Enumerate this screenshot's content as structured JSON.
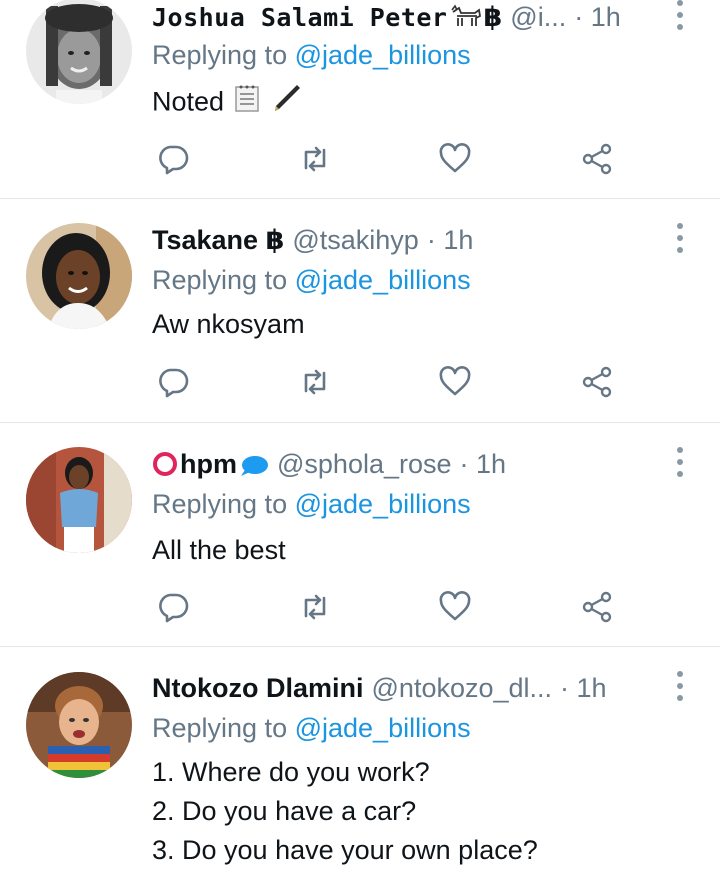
{
  "tweets": [
    {
      "name": "Joshua Salami Peter",
      "name_suffix": "฿",
      "handle": "@i...",
      "time": "· 1h",
      "replying_prefix": "Replying to ",
      "replying_to": "@jade_billions",
      "lines": [
        "Noted"
      ]
    },
    {
      "name": "Tsakane",
      "name_suffix": " ฿",
      "handle": "@tsakihyp",
      "time": "· 1h",
      "replying_prefix": "Replying to ",
      "replying_to": "@jade_billions",
      "lines": [
        "Aw nkosyam"
      ]
    },
    {
      "name": "hpm",
      "name_suffix": "",
      "handle": "@sphola_rose",
      "time": "· 1h",
      "replying_prefix": "Replying to ",
      "replying_to": "@jade_billions",
      "lines": [
        "All the best"
      ]
    },
    {
      "name": "Ntokozo Dlamini",
      "name_suffix": "",
      "handle": "@ntokozo_dl...",
      "time": "· 1h",
      "replying_prefix": "Replying to ",
      "replying_to": "@jade_billions",
      "lines": [
        "1. Where do you work?",
        "2. Do you have a car?",
        "3. Do you have your own place?"
      ]
    }
  ],
  "icons": {
    "reply": "reply-icon",
    "retweet": "retweet-icon",
    "like": "heart-icon",
    "share": "share-icon",
    "more": "more-vertical-icon"
  },
  "colors": {
    "icon_gray": "#657786",
    "mention_blue": "#1b95e0",
    "divider": "#e1e8ed",
    "circle_red": "#e0245e",
    "speech_blue": "#1d9bf0"
  }
}
